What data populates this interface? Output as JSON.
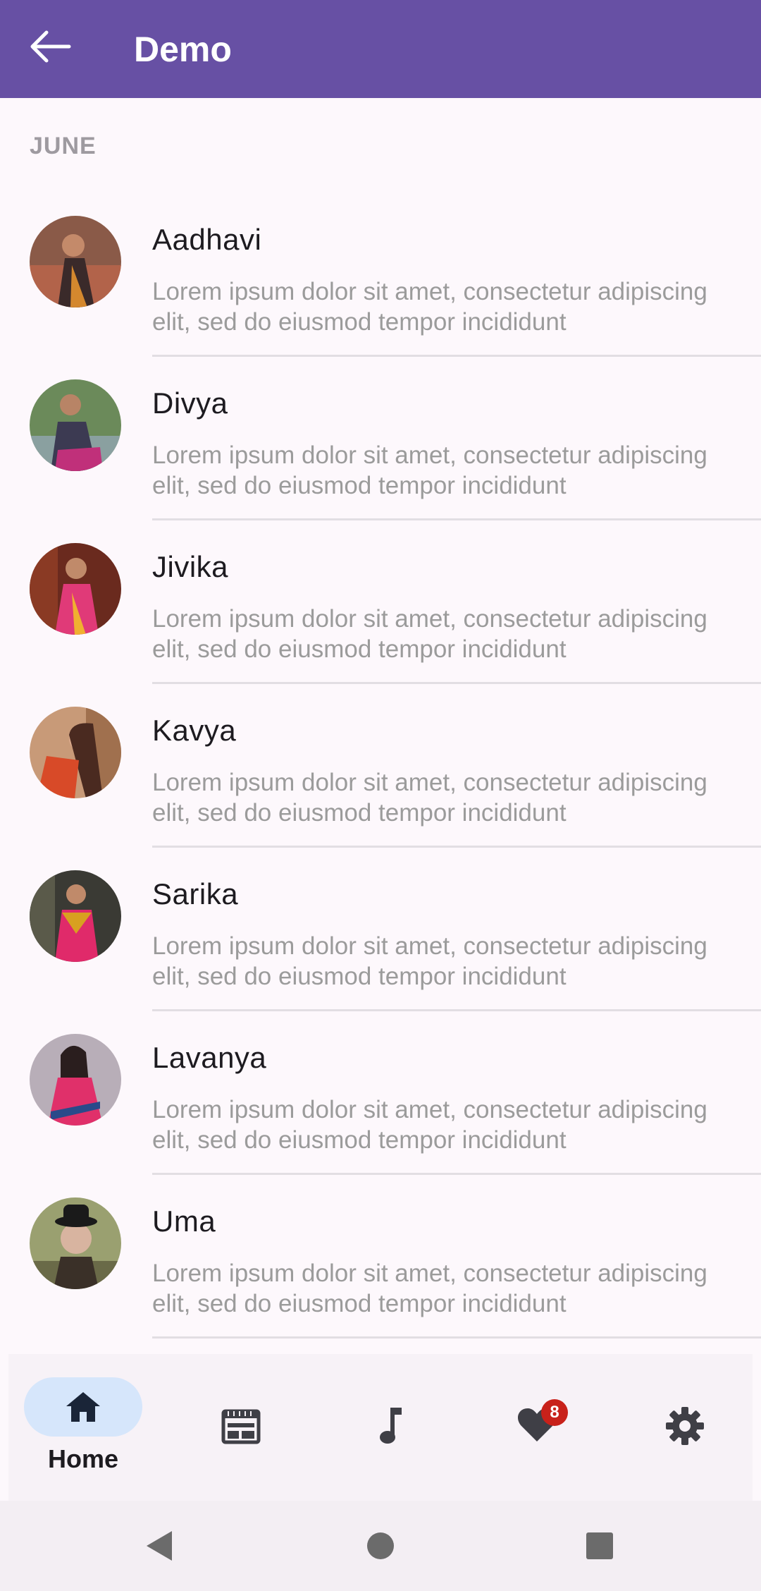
{
  "appbar": {
    "title": "Demo",
    "back_icon": "arrow-left-icon"
  },
  "section": {
    "header": "JUNE"
  },
  "items": [
    {
      "name": "Aadhavi",
      "description": "Lorem ipsum dolor sit amet, consectetur adipiscing elit, sed do eiusmod tempor incididunt"
    },
    {
      "name": "Divya",
      "description": "Lorem ipsum dolor sit amet, consectetur adipiscing elit, sed do eiusmod tempor incididunt"
    },
    {
      "name": "Jivika",
      "description": "Lorem ipsum dolor sit amet, consectetur adipiscing elit, sed do eiusmod tempor incididunt"
    },
    {
      "name": "Kavya",
      "description": "Lorem ipsum dolor sit amet, consectetur adipiscing elit, sed do eiusmod tempor incididunt"
    },
    {
      "name": "Sarika",
      "description": "Lorem ipsum dolor sit amet, consectetur adipiscing elit, sed do eiusmod tempor incididunt"
    },
    {
      "name": "Lavanya",
      "description": "Lorem ipsum dolor sit amet, consectetur adipiscing elit, sed do eiusmod tempor incididunt"
    },
    {
      "name": "Uma",
      "description": "Lorem ipsum dolor sit amet, consectetur adipiscing elit, sed do eiusmod tempor incididunt"
    }
  ],
  "bottom_nav": {
    "items": [
      {
        "label": "Home",
        "icon": "home-icon",
        "selected": true
      },
      {
        "label": "",
        "icon": "newspaper-icon",
        "selected": false
      },
      {
        "label": "",
        "icon": "music-note-icon",
        "selected": false
      },
      {
        "label": "",
        "icon": "heart-icon",
        "selected": false,
        "badge": "8"
      },
      {
        "label": "",
        "icon": "gear-icon",
        "selected": false
      }
    ]
  },
  "system_nav": {
    "back_icon": "triangle-back-icon",
    "home_icon": "circle-home-icon",
    "recents_icon": "square-recents-icon"
  },
  "colors": {
    "appbar": "#6750a4",
    "background": "#fdf8fc",
    "nav_pill": "#d6e6fb",
    "badge": "#c8211a",
    "secondary_text": "#9b9b9b"
  }
}
